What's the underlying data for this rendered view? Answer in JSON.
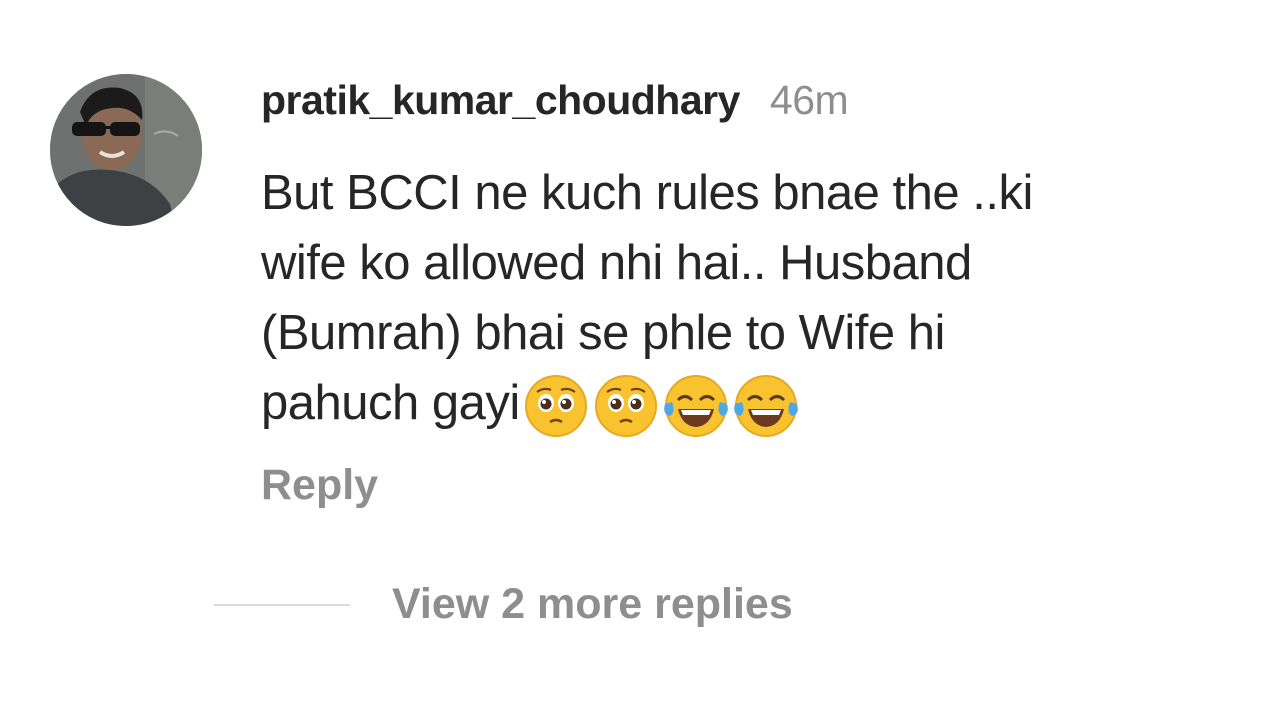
{
  "comment": {
    "avatar_icon": "user-avatar-photo",
    "username": "pratik_kumar_choudhary",
    "time": "46m",
    "text_lines": [
      "But BCCI ne kuch rules bnae the ..ki",
      "wife ko allowed nhi hai.. Husband",
      "(Bumrah) bhai se phle to Wife hi",
      "pahuch gayi"
    ],
    "emojis": [
      "pleading-face-icon",
      "pleading-face-icon",
      "tears-of-joy-icon",
      "tears-of-joy-icon"
    ],
    "reply_label": "Reply",
    "view_replies_label": "View 2 more replies"
  },
  "colors": {
    "text": "#262626",
    "muted": "#8e8e8e",
    "divider": "#dbdbdb",
    "emoji_yellow": "#f9c32f"
  }
}
